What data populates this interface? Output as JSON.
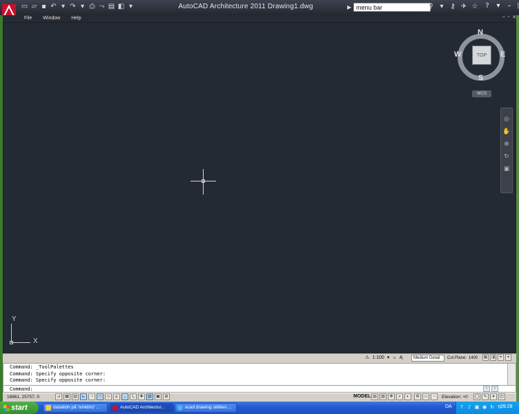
{
  "window": {
    "title": "AutoCAD Architecture 2011    Drawing1.dwg"
  },
  "search": {
    "value": "menu bar"
  },
  "quick_access": {
    "icons": [
      "new-icon",
      "open-icon",
      "save-icon",
      "undo-icon",
      "redo-icon",
      "print-icon",
      "publish-icon",
      "properties-icon",
      "workspace-icon",
      "dropdown-icon"
    ]
  },
  "menu": {
    "items": [
      {
        "label": "File"
      },
      {
        "label": "Window"
      },
      {
        "label": "Help"
      }
    ]
  },
  "viewcube": {
    "face": "TOP",
    "north": "N",
    "south": "S",
    "west": "W",
    "east": "E",
    "wcs": "WCS"
  },
  "ucs": {
    "x": "X",
    "y": "Y"
  },
  "annotation": {
    "scale": "1:100",
    "detail": "Medium Detail",
    "cut_plane_label": "Cut Plane:",
    "cut_plane_value": "1400"
  },
  "command": {
    "history": [
      "Command: _ToolPalettes",
      "Command: Specify opposite corner:",
      "Command: Specify opposite corner:"
    ],
    "prompt": "Command:"
  },
  "status": {
    "coords": "18861, 25757, 0",
    "model": "MODEL",
    "elevation_label": "Elevation:",
    "elevation_value": "+0"
  },
  "taskbar": {
    "start": "start",
    "tasks": [
      {
        "label": "datalkbh på 'nmkbhz' ..."
      },
      {
        "label": "AutoCAD Architectur..."
      },
      {
        "label": "acad drawing utilities ..."
      }
    ],
    "language": "DA",
    "clock": "09:28"
  },
  "colors": {
    "canvas": "#242a33",
    "titlebar": "#2f343d",
    "taskbar": "#245edb",
    "start": "#3f9e39",
    "autocad_red": "#c8102e"
  }
}
